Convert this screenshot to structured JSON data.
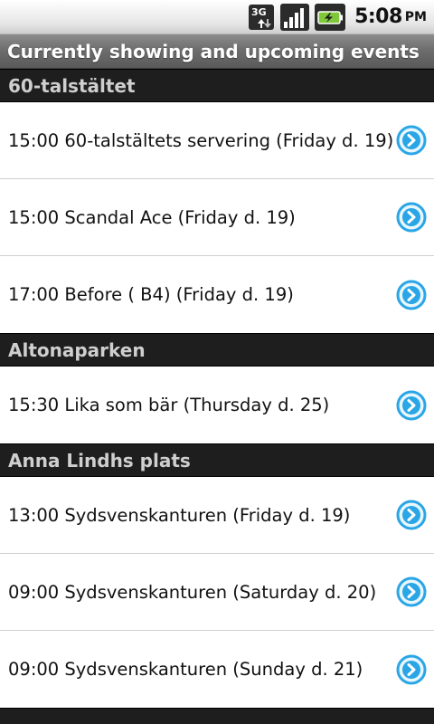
{
  "status_bar": {
    "network_label": "3G",
    "time": "5:08",
    "ampm": "PM",
    "icons": [
      "network-3g-icon",
      "signal-strength-icon",
      "battery-charging-icon"
    ]
  },
  "title": "Currently showing and upcoming events",
  "colors": {
    "section_header_bg": "#1e1e1e",
    "section_header_text": "#cfcfcf",
    "arrow_button": "#2aa6e6"
  },
  "sections": [
    {
      "name": "60-talstältet",
      "events": [
        {
          "label": "15:00 60-talstältets servering (Friday d. 19)"
        },
        {
          "label": "15:00 Scandal Ace (Friday d. 19)"
        },
        {
          "label": "17:00 Before ( B4) (Friday d. 19)"
        }
      ]
    },
    {
      "name": "Altonaparken",
      "events": [
        {
          "label": "15:30 Lika som bär (Thursday d. 25)"
        }
      ]
    },
    {
      "name": "Anna Lindhs plats",
      "events": [
        {
          "label": "13:00 Sydsvenskanturen (Friday d. 19)"
        },
        {
          "label": "09:00 Sydsvenskanturen (Saturday d. 20)"
        },
        {
          "label": "09:00 Sydsvenskanturen (Sunday d. 21)"
        }
      ]
    }
  ]
}
